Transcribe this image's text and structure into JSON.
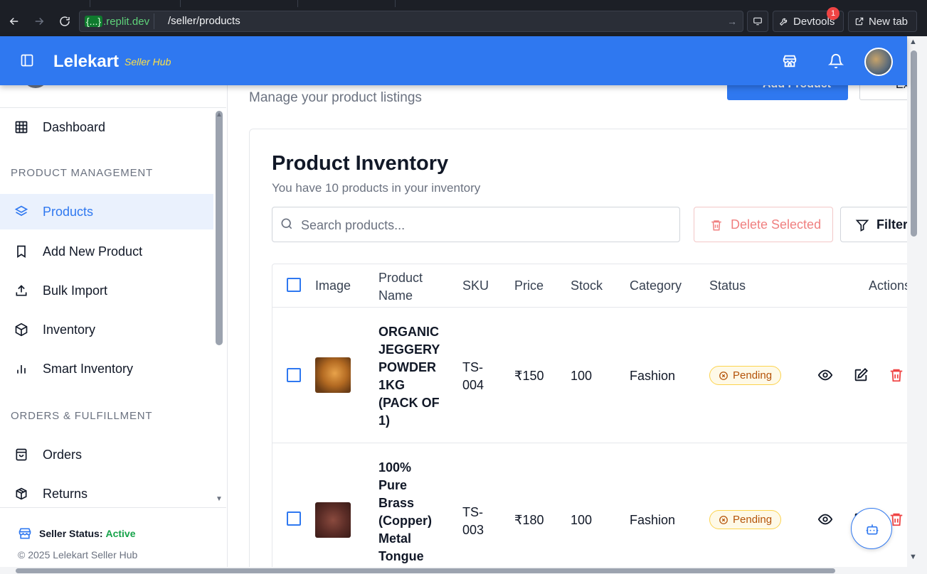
{
  "browser": {
    "url_host_braces": "{...}",
    "url_host": ".replit.dev",
    "url_path": "/seller/products",
    "devtools_label": "Devtools",
    "devtools_badge": "1",
    "new_tab_label": "New tab"
  },
  "header": {
    "brand": "Lelekart",
    "brand_sub": "Seller Hub"
  },
  "sidebar": {
    "dashboard": "Dashboard",
    "section_product": "PRODUCT MANAGEMENT",
    "items_product": [
      "Products",
      "Add New Product",
      "Bulk Import",
      "Inventory",
      "Smart Inventory"
    ],
    "section_orders": "ORDERS & FULFILLMENT",
    "items_orders": [
      "Orders",
      "Returns"
    ],
    "status_label": "Seller Status:",
    "status_value": "Active",
    "copyright": "© 2025 Lelekart Seller Hub"
  },
  "main": {
    "subtitle": "Manage your product listings",
    "add_button": "Add Product",
    "export_button": "Ex",
    "card_title": "Product Inventory",
    "card_desc": "You have 10 products in your inventory",
    "search_placeholder": "Search products...",
    "delete_selected": "Delete Selected",
    "filters": "Filters"
  },
  "table": {
    "headers": {
      "image": "Image",
      "name_1": "Product",
      "name_2": "Name",
      "sku": "SKU",
      "price": "Price",
      "stock": "Stock",
      "category": "Category",
      "status": "Status",
      "actions": "Actions"
    },
    "rows": [
      {
        "name_lines": [
          "ORGANIC",
          "JEGGERY",
          "POWDER",
          "1KG",
          "(PACK OF",
          "1)"
        ],
        "sku_lines": [
          "TS-",
          "004"
        ],
        "price": "₹150",
        "stock": "100",
        "category": "Fashion",
        "status": "Pending"
      },
      {
        "name_lines": [
          "100%",
          "Pure",
          "Brass",
          "(Copper)",
          "Metal",
          "Tongue"
        ],
        "sku_lines": [
          "TS-",
          "003"
        ],
        "price": "₹180",
        "stock": "100",
        "category": "Fashion",
        "status": "Pending"
      }
    ]
  },
  "colors": {
    "accent": "#2f78f0",
    "active_green": "#16a34a",
    "pending": "#b45309",
    "danger": "#ef4444"
  }
}
